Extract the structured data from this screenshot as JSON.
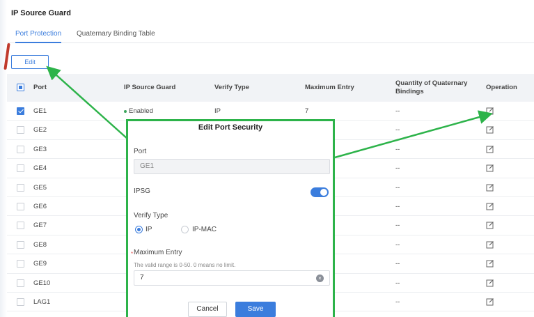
{
  "page": {
    "title": "IP Source Guard"
  },
  "tabs": [
    {
      "label": "Port Protection",
      "active": true
    },
    {
      "label": "Quaternary Binding Table",
      "active": false
    }
  ],
  "toolbar": {
    "edit_label": "Edit"
  },
  "table": {
    "headers": {
      "port": "Port",
      "ipsg": "IP Source Guard",
      "verify_type": "Verify Type",
      "max_entry": "Maximum Entry",
      "quantity": "Quantity of Quaternary Bindings",
      "operation": "Operation"
    },
    "rows": [
      {
        "port": "GE1",
        "checked": true,
        "ipsg": "Enabled",
        "verify": "IP",
        "max": "7",
        "qty": "--"
      },
      {
        "port": "GE2",
        "checked": false,
        "ipsg": "",
        "verify": "",
        "max": "",
        "qty": "--"
      },
      {
        "port": "GE3",
        "checked": false,
        "ipsg": "",
        "verify": "",
        "max": "",
        "qty": "--"
      },
      {
        "port": "GE4",
        "checked": false,
        "ipsg": "",
        "verify": "",
        "max": "",
        "qty": "--"
      },
      {
        "port": "GE5",
        "checked": false,
        "ipsg": "",
        "verify": "",
        "max": "",
        "qty": "--"
      },
      {
        "port": "GE6",
        "checked": false,
        "ipsg": "",
        "verify": "",
        "max": "",
        "qty": "--"
      },
      {
        "port": "GE7",
        "checked": false,
        "ipsg": "",
        "verify": "",
        "max": "",
        "qty": "--"
      },
      {
        "port": "GE8",
        "checked": false,
        "ipsg": "",
        "verify": "",
        "max": "",
        "qty": "--"
      },
      {
        "port": "GE9",
        "checked": false,
        "ipsg": "",
        "verify": "",
        "max": "",
        "qty": "--"
      },
      {
        "port": "GE10",
        "checked": false,
        "ipsg": "",
        "verify": "",
        "max": "",
        "qty": "--"
      },
      {
        "port": "LAG1",
        "checked": false,
        "ipsg": "",
        "verify": "",
        "max": "",
        "qty": "--"
      }
    ]
  },
  "modal": {
    "title": "Edit Port Security",
    "port_label": "Port",
    "port_value": "GE1",
    "ipsg_label": "IPSG",
    "ipsg_on": true,
    "verify_label": "Verify Type",
    "verify_options": [
      "IP",
      "IP-MAC"
    ],
    "verify_selected": "IP",
    "max_label": "Maximum Entry",
    "max_required_mark": "*",
    "max_hint": "The valid range is 0-50. 0 means no limit.",
    "max_value": "7",
    "cancel_label": "Cancel",
    "save_label": "Save"
  },
  "icons": {
    "edit": "edit-icon",
    "clear": "clear-icon"
  },
  "colors": {
    "accent": "#3b7ddd",
    "annotation": "#2db34a",
    "enabled_dot": "#3ca55c"
  }
}
